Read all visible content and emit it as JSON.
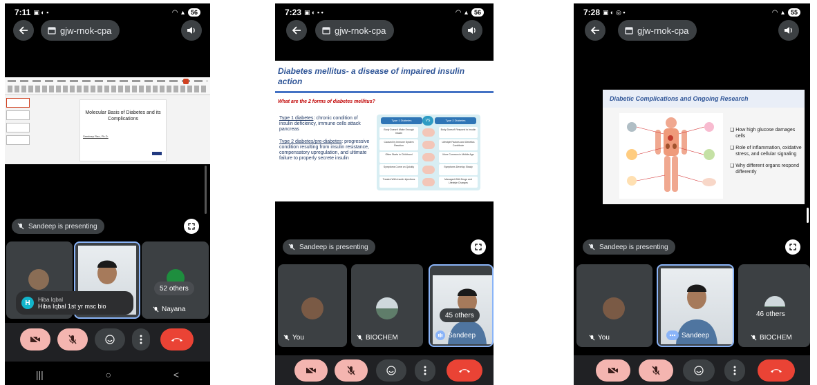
{
  "colors": {
    "background": "#000000",
    "tile": "#3c4043",
    "active_border": "#8ab4f8",
    "pink_button": "#f4b5b0",
    "end_call": "#ea4335"
  },
  "phones": [
    {
      "status": {
        "time": "7:11",
        "battery": "56"
      },
      "meeting_code": "gjw-rnok-cpa",
      "presenting": "Sandeep is presenting",
      "slide": {
        "title": "Molecular Basis of Diabetes and its Complications",
        "subtitle": "Sandeep Rao, Ph.D."
      },
      "tiles": {
        "others_count": "52 others",
        "other_name": "Nayana"
      },
      "toast": {
        "initial": "H",
        "name": "Hiba Iqbal",
        "message": "Hiba Iqbal 1st yr msc bio"
      },
      "nav": {
        "recents": "|||",
        "home": "○",
        "back": "<"
      }
    },
    {
      "status": {
        "time": "7:23",
        "battery": "56"
      },
      "meeting_code": "gjw-rnok-cpa",
      "presenting": "Sandeep is presenting",
      "slide": {
        "title": "Diabetes mellitus- a disease of impaired insulin action",
        "question": "What are the 2 forms of diabetes mellitus?",
        "t1_link": "Type 1 diabetes",
        "t1_text": ": chronic condition of insulin deficiency, immune cells attack pancreas",
        "t2_link": "Type 2 diabetes/pre-diabetes",
        "t2_text": ": progressive condition resulting from insulin resistance, compensatory upregulation, and ultimate failure to properly secrete insulin",
        "vs": "VS",
        "col1": "Type 1 Diabetes",
        "col2": "Type 2 Diabetes",
        "rows_left": [
          "Body Doesn't Make Enough Insulin",
          "Caused by Immune System Reaction",
          "Often Starts in Childhood",
          "Symptoms Come on Quickly",
          "Treated With Insulin Injections"
        ],
        "rows_right": [
          "Body Doesn't Respond to Insulin",
          "Lifestyle Factors and Genetics Contribute",
          "More Common in Middle Age",
          "Symptoms Develop Slowly",
          "Managed With Drugs and Lifestyle Changes"
        ]
      },
      "tiles": {
        "you": "You",
        "biochem": "BIOCHEM",
        "sandeep": "Sandeep",
        "others_count": "45 others"
      }
    },
    {
      "status": {
        "time": "7:28",
        "battery": "55"
      },
      "meeting_code": "gjw-rnok-cpa",
      "presenting": "Sandeep is presenting",
      "slide": {
        "title": "Diabetic Complications and Ongoing Research",
        "bullets": [
          "How high glucose damages cells",
          "Role of inflammation, oxidative stress, and cellular signaling",
          "Why different organs respond differently"
        ]
      },
      "tiles": {
        "you": "You",
        "sandeep": "Sandeep",
        "biochem": "BIOCHEM",
        "others_count": "46 others"
      }
    }
  ]
}
